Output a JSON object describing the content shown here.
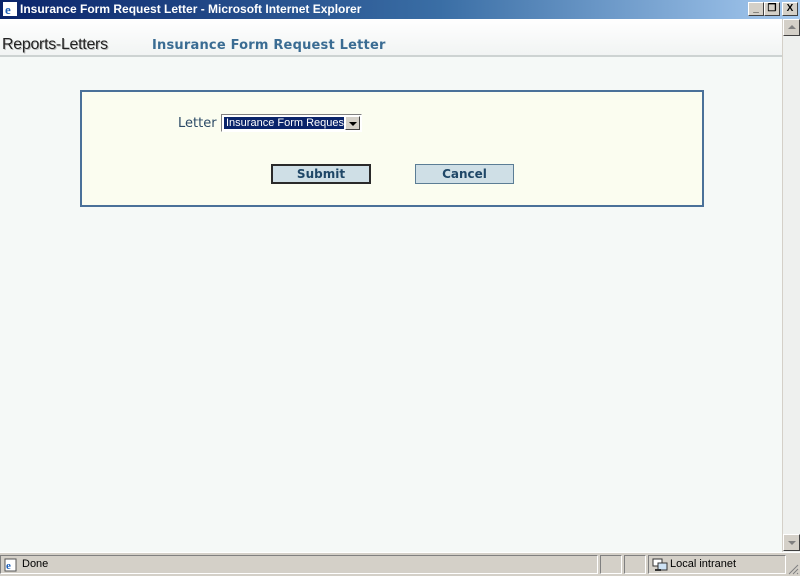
{
  "window": {
    "title": "Insurance Form Request Letter - Microsoft Internet Explorer",
    "icon": "ie-icon",
    "controls": {
      "minimize": "_",
      "maximize": "❐",
      "close": "X"
    }
  },
  "header": {
    "brand": "Reports-Letters",
    "page_title": "Insurance Form Request Letter"
  },
  "form": {
    "letter_label": "Letter",
    "letter_select": {
      "selected": "Insurance Form Request"
    },
    "submit_label": "Submit",
    "cancel_label": "Cancel"
  },
  "statusbar": {
    "status_text": "Done",
    "zone_text": "Local intranet"
  },
  "colors": {
    "titlebar_start": "#0a246a",
    "panel_border": "#4a7199",
    "panel_bg": "#fbfdf0",
    "page_title": "#3a6c93",
    "button_bg": "#cfdfe6"
  }
}
